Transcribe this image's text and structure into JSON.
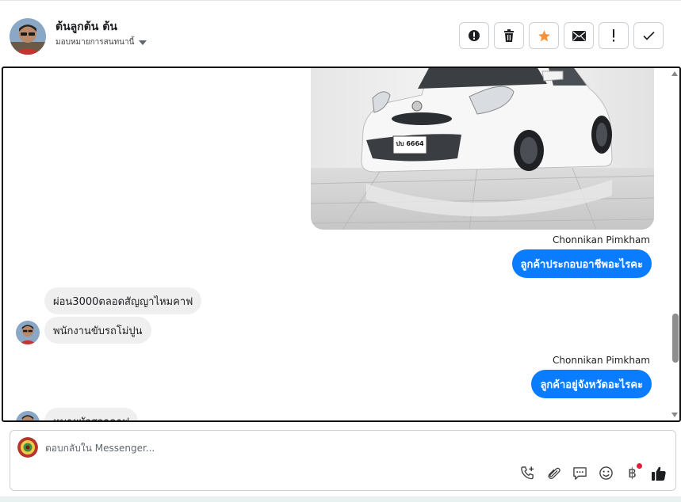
{
  "header": {
    "contact_name": "ต้นลูกต้น ต้น",
    "assign_label": "มอบหมายการสนทนานี้",
    "actions": [
      {
        "icon": "alert-circle-icon"
      },
      {
        "icon": "trash-icon"
      },
      {
        "icon": "star-icon"
      },
      {
        "icon": "envelope-icon"
      },
      {
        "icon": "exclamation-icon"
      },
      {
        "icon": "checkmark-icon"
      }
    ]
  },
  "thread": {
    "messages": [
      {
        "direction": "outgoing",
        "type": "image",
        "alt": "car-photo"
      },
      {
        "direction": "outgoing",
        "sender": "Chonnikan Pimkham",
        "text": "ลูกค้าประกอบอาชีพอะไรคะ"
      },
      {
        "direction": "incoming",
        "text": "ผ่อน3000ตลอดสัญญาไหมคาฟ"
      },
      {
        "direction": "incoming",
        "text": "พนักงานขับรถโม่ปูน"
      },
      {
        "direction": "outgoing",
        "sender": "Chonnikan Pimkham",
        "text": "ลูกค้าอยู่จังหวัดอะไรคะ"
      },
      {
        "direction": "incoming",
        "text": "หมายหัวสวกคาฟ"
      }
    ]
  },
  "car_plate": "ปบ 6664",
  "composer": {
    "placeholder": "ตอบกลับใน Messenger...",
    "tools": [
      "phone-add-icon",
      "paperclip-icon",
      "saved-reply-icon",
      "emoji-icon",
      "baht-icon",
      "thumbs-up-icon"
    ],
    "baht_symbol": "฿"
  },
  "colors": {
    "outgoing_bubble": "#0a7cff",
    "incoming_bubble": "#efefef",
    "star": "#f7923a",
    "notification": "#e41e3f"
  }
}
